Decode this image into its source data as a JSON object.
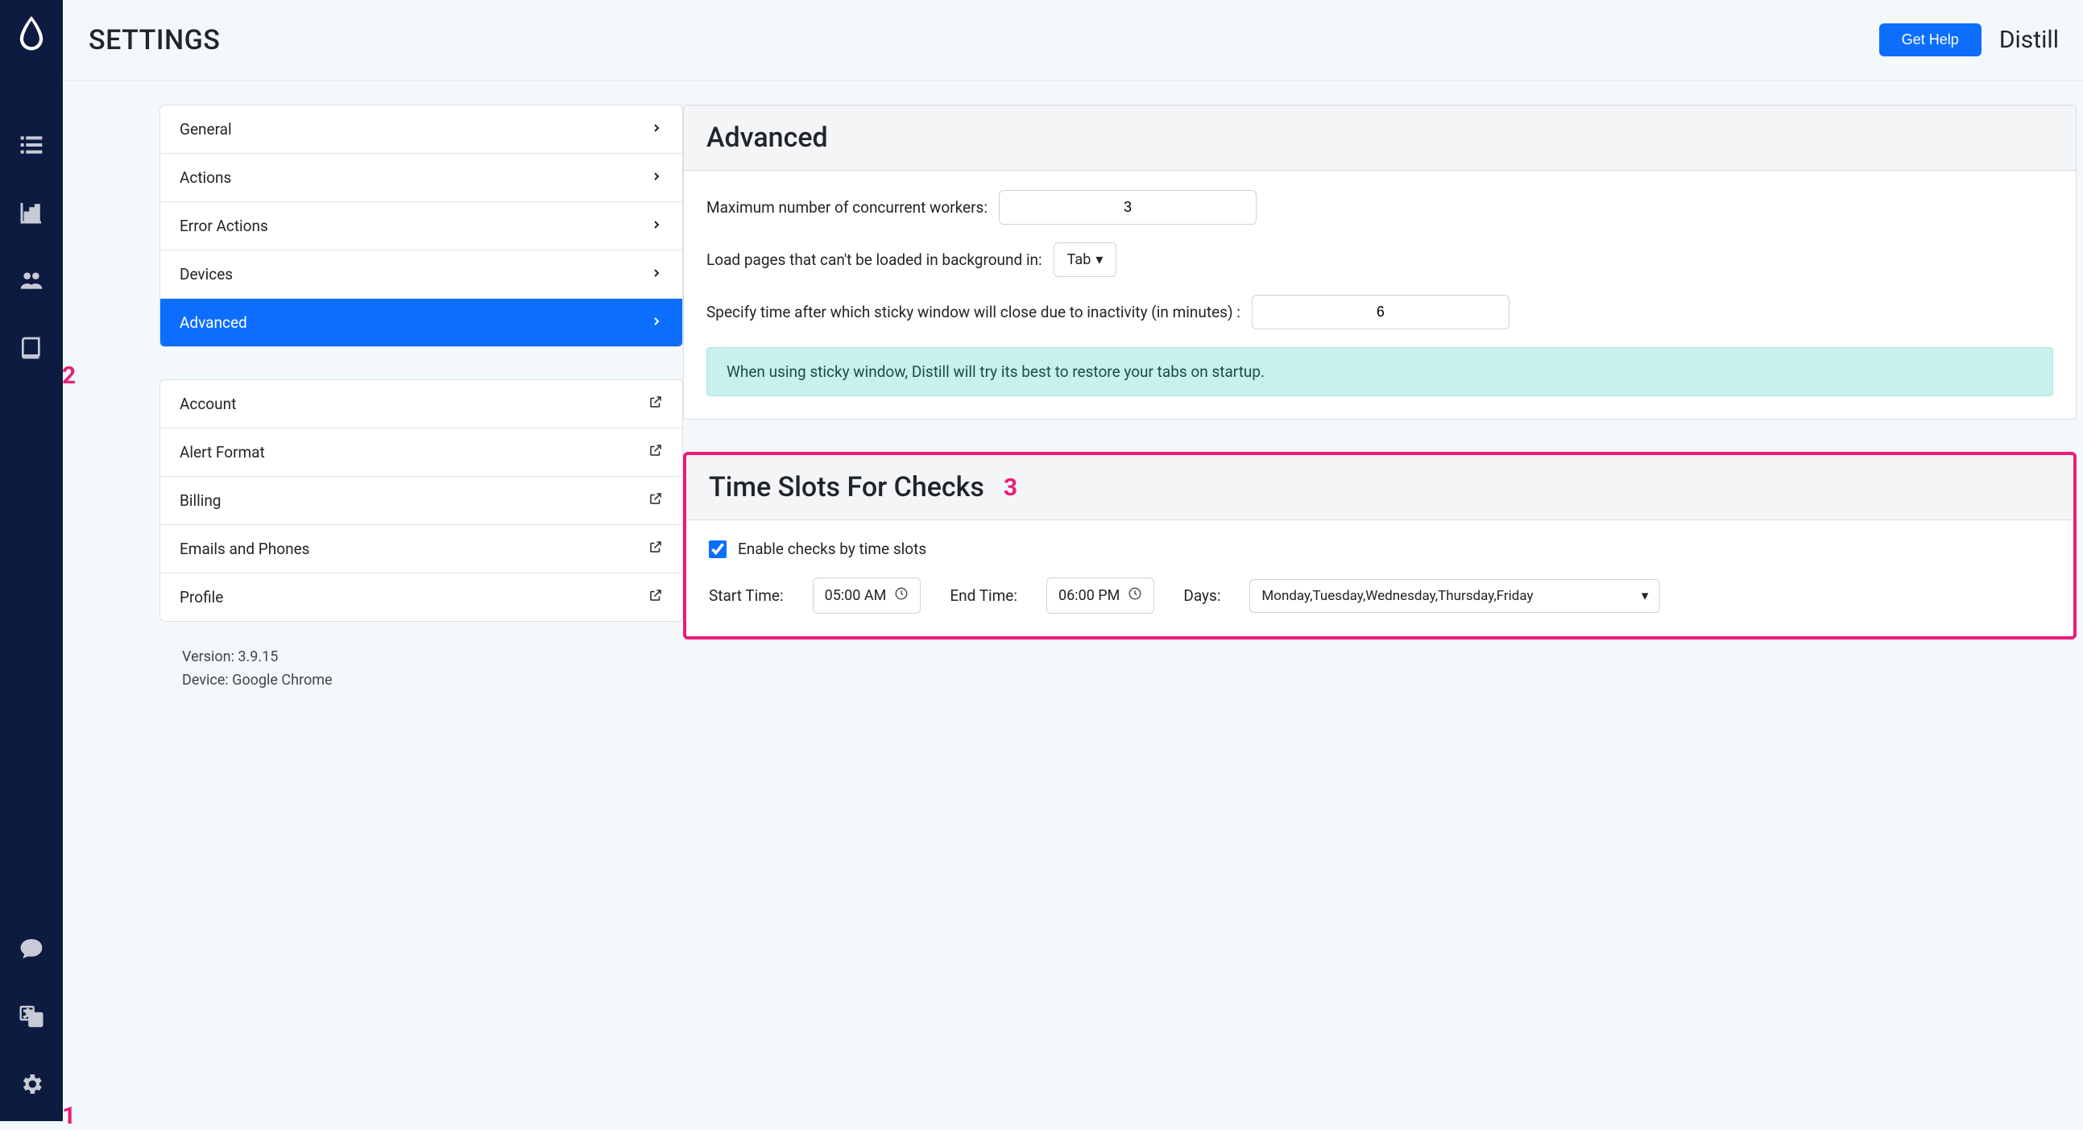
{
  "header": {
    "title": "SETTINGS",
    "get_help": "Get Help",
    "brand": "Distill"
  },
  "side_group1": [
    {
      "label": "General"
    },
    {
      "label": "Actions"
    },
    {
      "label": "Error Actions"
    },
    {
      "label": "Devices"
    },
    {
      "label": "Advanced",
      "active": true
    }
  ],
  "side_group2": [
    {
      "label": "Account"
    },
    {
      "label": "Alert Format"
    },
    {
      "label": "Billing"
    },
    {
      "label": "Emails and Phones"
    },
    {
      "label": "Profile"
    }
  ],
  "meta": {
    "version_label": "Version: 3.9.15",
    "device_label": "Device: Google Chrome"
  },
  "advanced": {
    "title": "Advanced",
    "max_workers_label": "Maximum number of concurrent workers:",
    "max_workers_value": "3",
    "load_pages_label": "Load pages that can't be loaded in background in:",
    "load_pages_value": "Tab",
    "sticky_time_label": "Specify time after which sticky window will close due to inactivity (in minutes) :",
    "sticky_time_value": "6",
    "sticky_info": "When using sticky window, Distill will try its best to restore your tabs on startup."
  },
  "timeslots": {
    "title": "Time Slots For Checks",
    "enable_label": "Enable checks by time slots",
    "enabled": true,
    "start_label": "Start Time:",
    "start_value": "05:00 AM",
    "end_label": "End Time:",
    "end_value": "06:00 PM",
    "days_label": "Days:",
    "days_value": "Monday,Tuesday,Wednesday,Thursday,Friday"
  },
  "annotations": {
    "one": "1",
    "two": "2",
    "three": "3"
  }
}
